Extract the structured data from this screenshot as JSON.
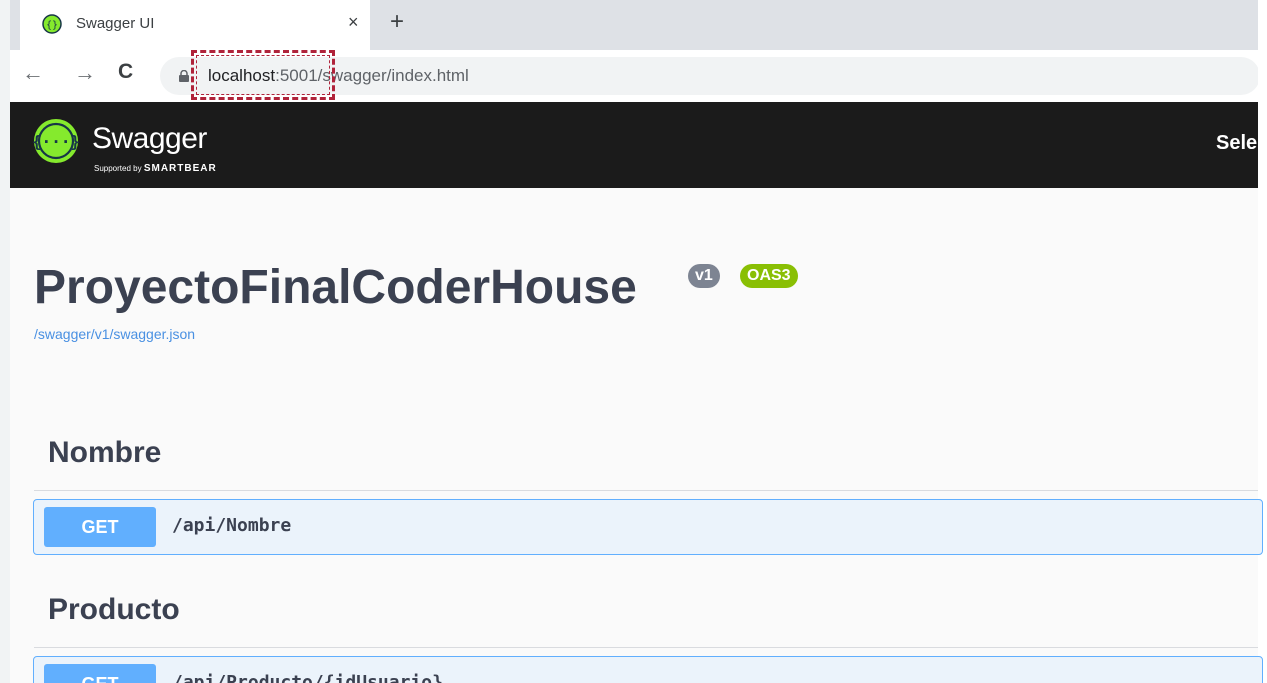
{
  "browser": {
    "tab_title": "Swagger UI",
    "close_glyph": "×",
    "new_tab_glyph": "+",
    "back_glyph": "←",
    "forward_glyph": "→",
    "reload_glyph": "C",
    "url_host": "localhost",
    "url_port": ":5001",
    "url_path": "/swagger/index.html"
  },
  "topbar": {
    "logo_text": "Swagger",
    "logo_sub_prefix": "Supported by ",
    "logo_sub_brand": "SMARTBEAR",
    "select_label": "Sele"
  },
  "info": {
    "title": "ProyectoFinalCoderHouse",
    "version_badge": "v1",
    "oas_badge": "OAS3",
    "spec_link": "/swagger/v1/swagger.json"
  },
  "tags": [
    {
      "name": "Nombre",
      "operations": [
        {
          "method": "GET",
          "path": "/api/Nombre"
        }
      ]
    },
    {
      "name": "Producto",
      "operations": [
        {
          "method": "GET",
          "path": "/api/Producto/{idUsuario}"
        }
      ]
    }
  ],
  "colors": {
    "topbar_bg": "#1b1b1b",
    "get_method": "#61affe",
    "get_bg": "#ebf3fb",
    "oas_badge": "#89bf04",
    "version_badge": "#7d8492",
    "highlight": "#b0233a"
  }
}
